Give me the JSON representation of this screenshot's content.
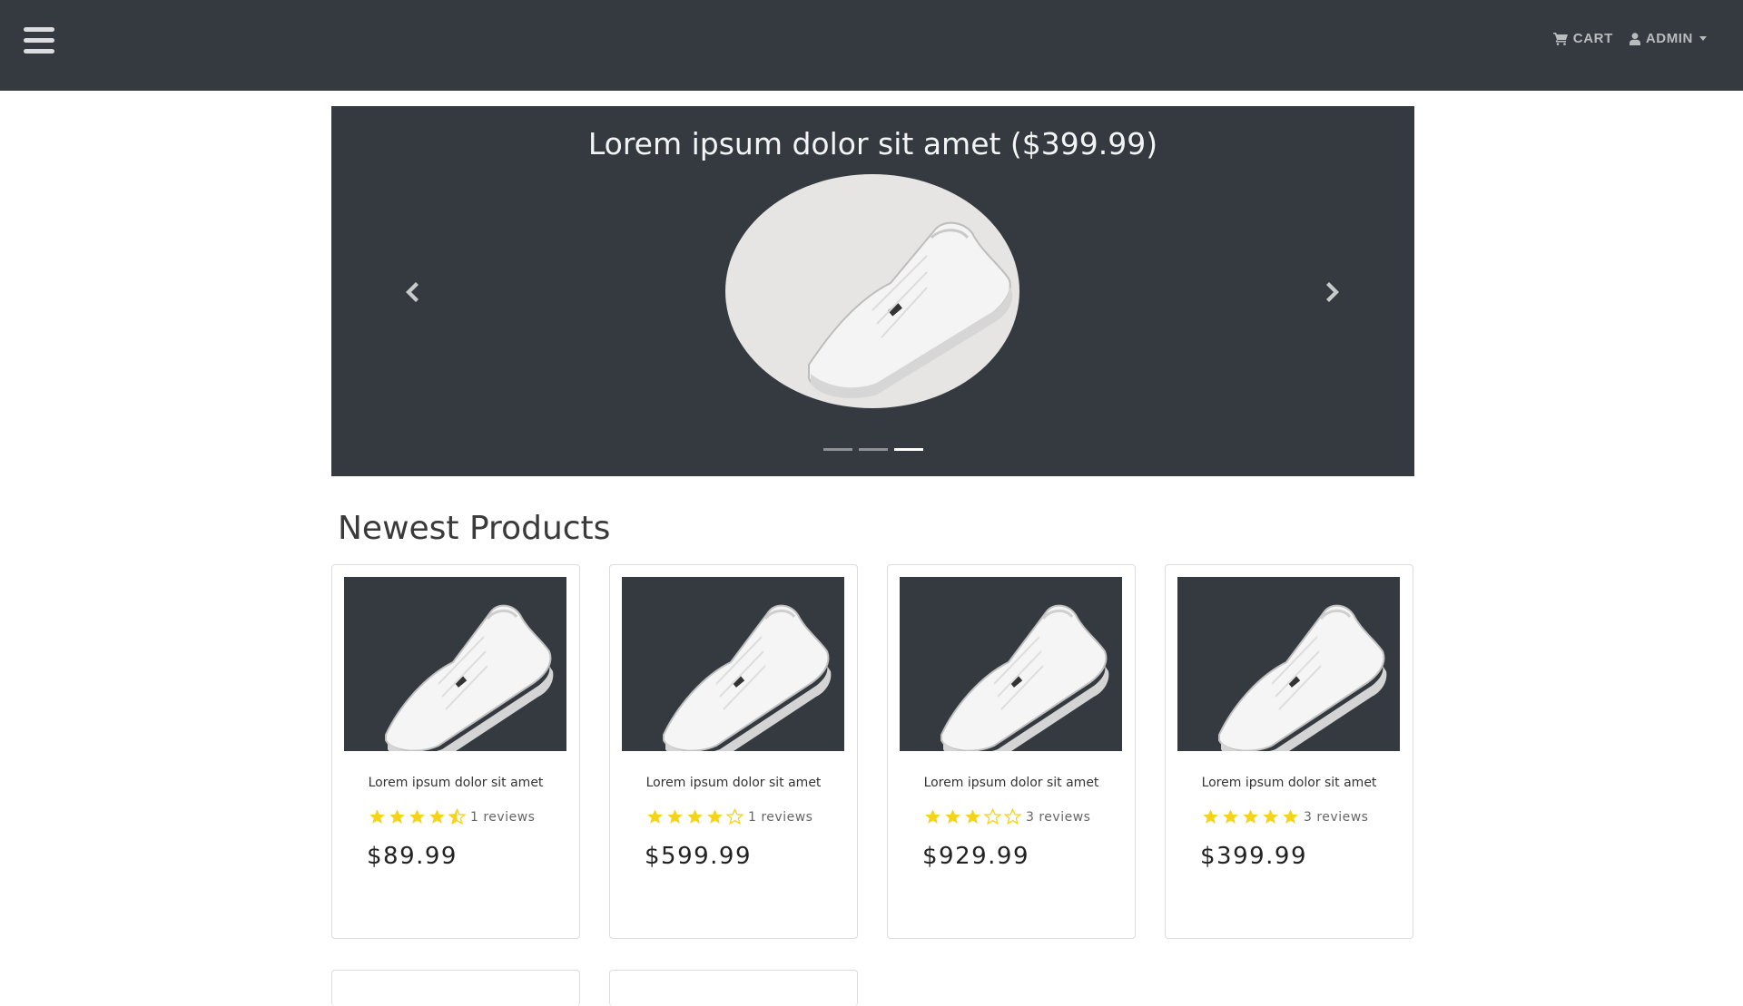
{
  "navbar": {
    "menu_icon": "hamburger-icon",
    "cart_label": "CART",
    "cart_icon": "cart-icon",
    "user_label": "ADMIN",
    "user_icon": "user-icon"
  },
  "carousel": {
    "title": "Lorem ipsum dolor sit amet ($399.99)",
    "prev_icon": "chevron-left-icon",
    "next_icon": "chevron-right-icon",
    "slide_count": 3,
    "active_slide": 3
  },
  "section": {
    "title": "Newest Products"
  },
  "products": [
    {
      "name": "Lorem ipsum dolor sit amet",
      "rating": 4.5,
      "reviews": "1 reviews",
      "price": "$89.99"
    },
    {
      "name": "Lorem ipsum dolor sit amet",
      "rating": 4,
      "reviews": "1 reviews",
      "price": "$599.99"
    },
    {
      "name": "Lorem ipsum dolor sit amet",
      "rating": 3,
      "reviews": "3 reviews",
      "price": "$929.99"
    },
    {
      "name": "Lorem ipsum dolor sit amet",
      "rating": 5,
      "reviews": "3 reviews",
      "price": "$399.99"
    }
  ],
  "colors": {
    "navbar_bg": "#343a40",
    "star": "#f5d31a",
    "nav_text": "#b9bcbf"
  }
}
